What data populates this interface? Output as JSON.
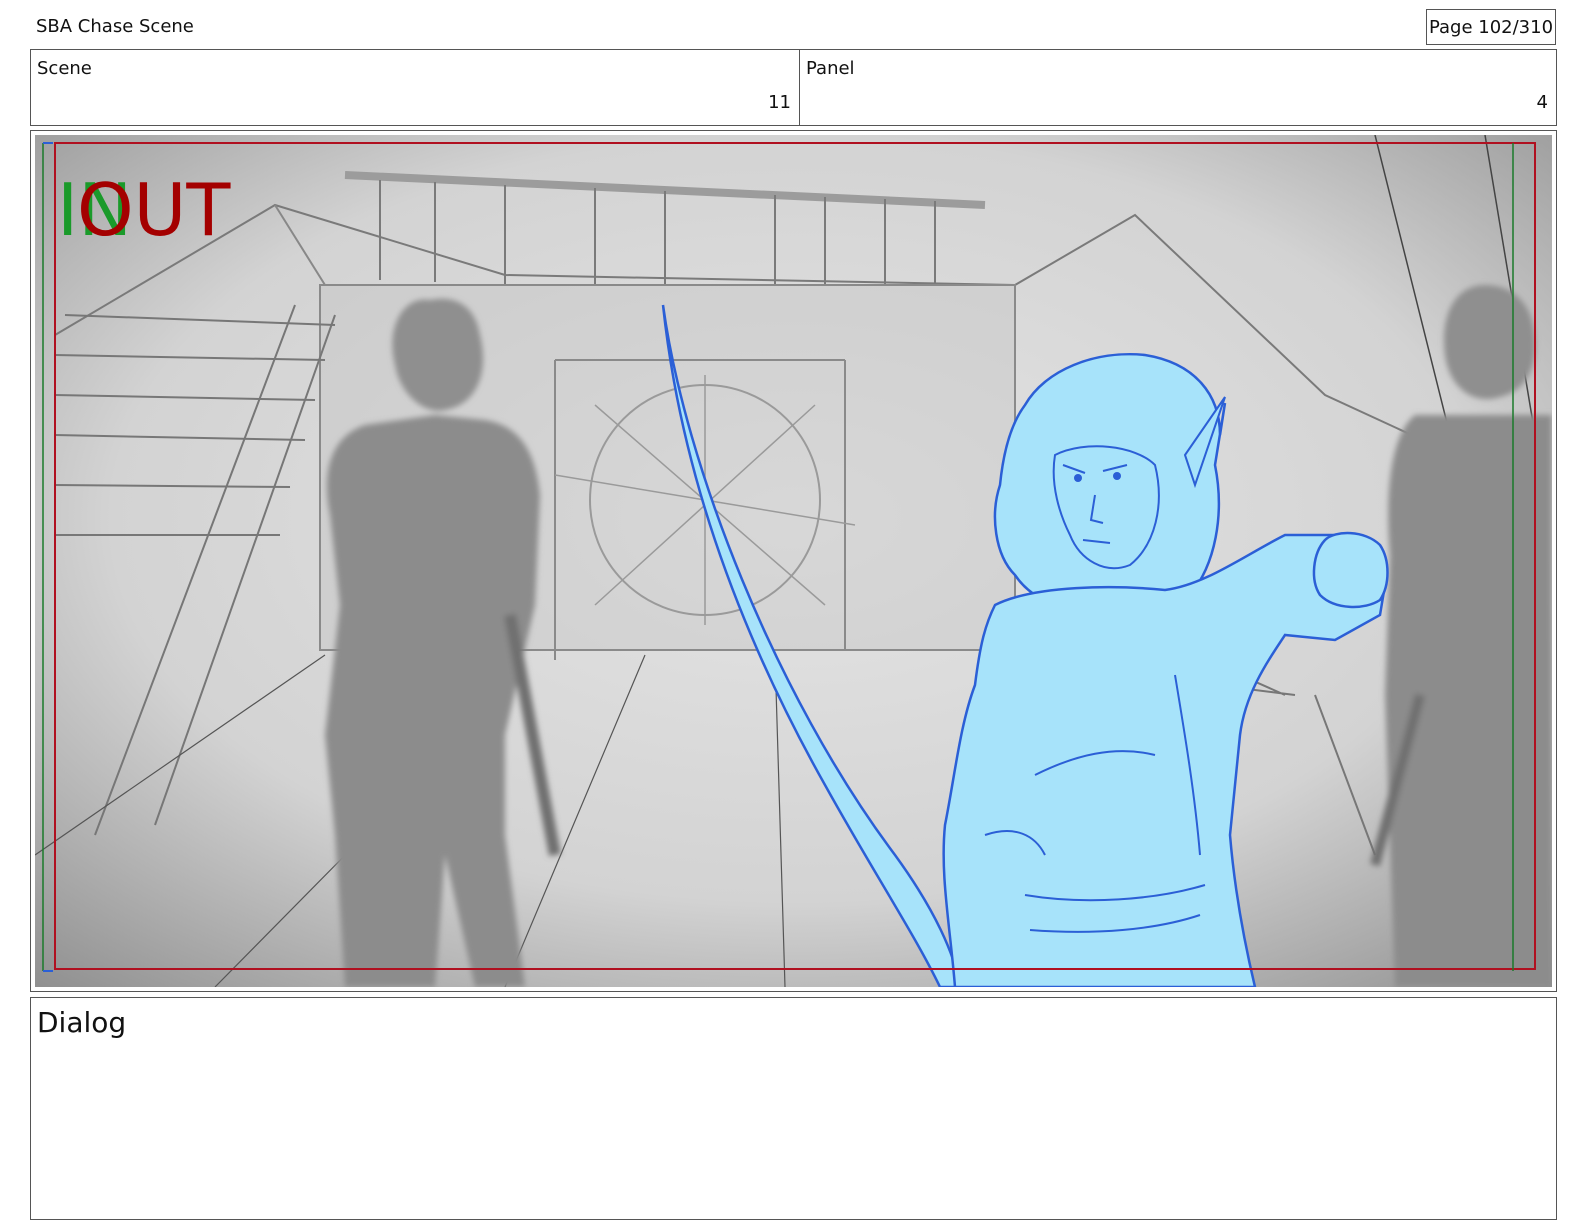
{
  "header": {
    "doc_title": "SBA Chase Scene",
    "page_label": "Page 102/310"
  },
  "info": {
    "scene_label": "Scene",
    "scene_value": "11",
    "panel_label": "Panel",
    "panel_value": "4"
  },
  "panel": {
    "in_marker": "IN",
    "out_marker": "OUT",
    "colors": {
      "in_marker": "#1a9a2a",
      "out_marker": "#a40000",
      "safe_frame": "#b01020",
      "character_fill": "#a7e3fa",
      "character_line": "#2b5fd6",
      "sketch_line": "#6a6a6a"
    }
  },
  "dialog": {
    "label": "Dialog"
  }
}
